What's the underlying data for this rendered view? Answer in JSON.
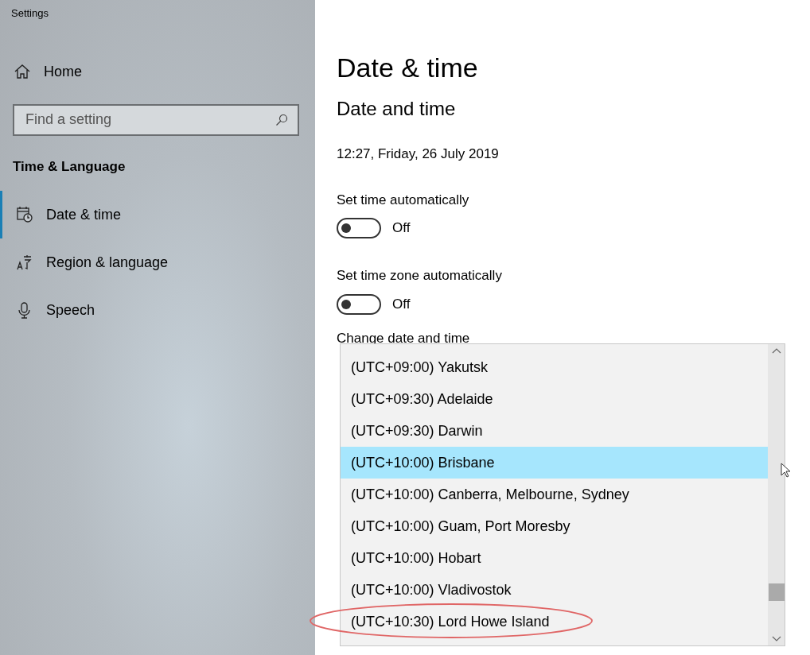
{
  "window": {
    "title": "Settings"
  },
  "sidebar": {
    "home": "Home",
    "search": {
      "placeholder": "Find a setting"
    },
    "section": "Time & Language",
    "items": [
      {
        "label": "Date & time",
        "kind": "calendar",
        "selected": true
      },
      {
        "label": "Region & language",
        "kind": "language",
        "selected": false
      },
      {
        "label": "Speech",
        "kind": "microphone",
        "selected": false
      }
    ]
  },
  "page": {
    "title": "Date & time",
    "heading": "Date and time",
    "current": "12:27, Friday, 26 July 2019",
    "toggles": [
      {
        "label": "Set time automatically",
        "on": false,
        "state": "Off"
      },
      {
        "label": "Set time zone automatically",
        "on": false,
        "state": "Off"
      }
    ],
    "change_label": "Change date and time"
  },
  "timezone_list": {
    "items": [
      {
        "label": "(UTC+09:00) Yakutsk",
        "selected": false,
        "circled": false
      },
      {
        "label": "(UTC+09:30) Adelaide",
        "selected": false,
        "circled": false
      },
      {
        "label": "(UTC+09:30) Darwin",
        "selected": false,
        "circled": false
      },
      {
        "label": "(UTC+10:00) Brisbane",
        "selected": true,
        "circled": false
      },
      {
        "label": "(UTC+10:00) Canberra, Melbourne, Sydney",
        "selected": false,
        "circled": false
      },
      {
        "label": "(UTC+10:00) Guam, Port Moresby",
        "selected": false,
        "circled": false
      },
      {
        "label": "(UTC+10:00) Hobart",
        "selected": false,
        "circled": false
      },
      {
        "label": "(UTC+10:00) Vladivostok",
        "selected": false,
        "circled": false
      },
      {
        "label": "(UTC+10:30) Lord Howe Island",
        "selected": false,
        "circled": true
      }
    ]
  }
}
